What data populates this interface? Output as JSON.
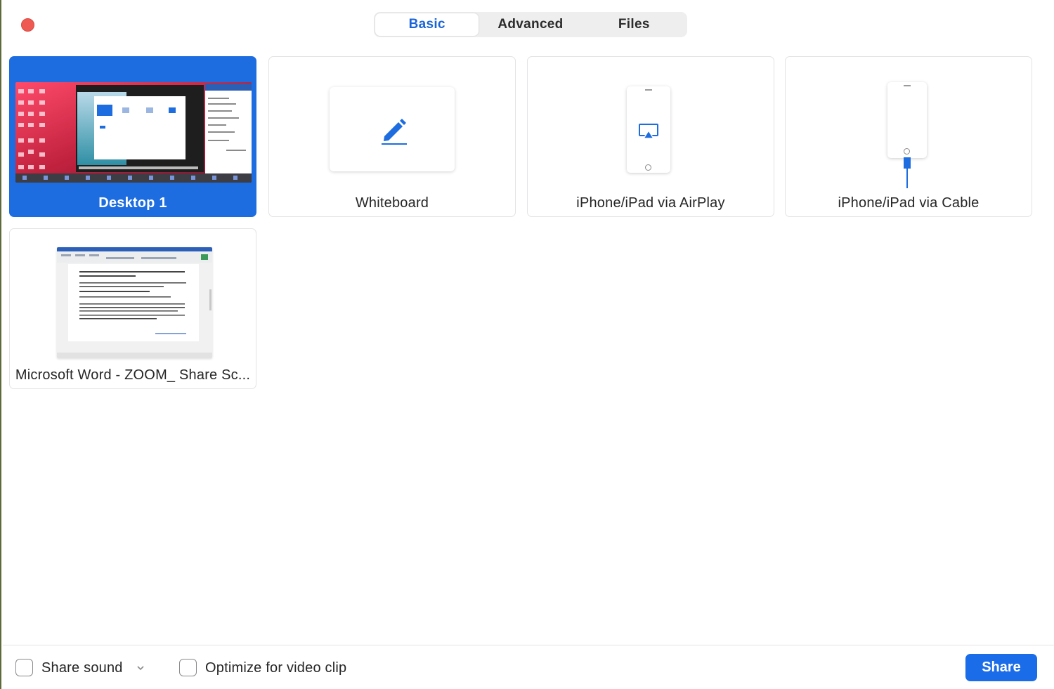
{
  "tabs": [
    {
      "label": "Basic",
      "active": true
    },
    {
      "label": "Advanced",
      "active": false
    },
    {
      "label": "Files",
      "active": false
    }
  ],
  "tiles": {
    "desktop": "Desktop 1",
    "whiteboard": "Whiteboard",
    "airplay": "iPhone/iPad via AirPlay",
    "cable": "iPhone/iPad via Cable",
    "word": "Microsoft Word - ZOOM_ Share Sc..."
  },
  "footer": {
    "share_sound": "Share sound",
    "optimize_video": "Optimize for video clip",
    "share_button": "Share"
  },
  "colors": {
    "accent": "#1a6ce8",
    "close": "#ee5a52"
  }
}
